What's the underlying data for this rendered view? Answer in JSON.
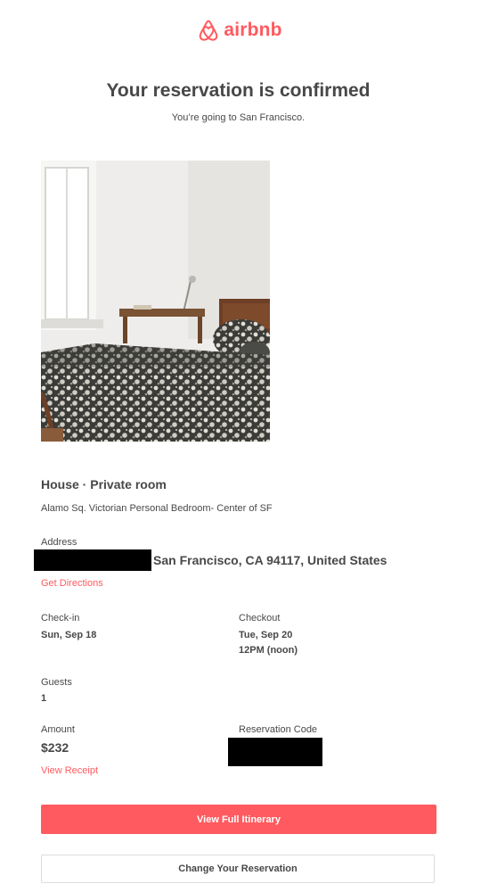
{
  "brand": {
    "name": "airbnb",
    "logo_icon": "airbnb-belo-icon",
    "color": "#FF5A5F"
  },
  "header": {
    "title": "Your reservation is confirmed",
    "subtitle": "You’re going to San Francisco."
  },
  "listing": {
    "photo_icon": "bedroom-photo",
    "room_type": "House · Private room",
    "name": "Alamo Sq. Victorian Personal Bedroom- Center of SF"
  },
  "address": {
    "label": "Address",
    "street_redacted": true,
    "text": "San Francisco, CA 94117, United States",
    "directions_link": "Get Directions"
  },
  "checkin": {
    "label": "Check-in",
    "date": "Sun, Sep 18"
  },
  "checkout": {
    "label": "Checkout",
    "date": "Tue, Sep 20",
    "time": "12PM (noon)"
  },
  "guests": {
    "label": "Guests",
    "count": "1"
  },
  "amount": {
    "label": "Amount",
    "value": "$232",
    "receipt_link": "View Receipt"
  },
  "reservation_code": {
    "label": "Reservation Code",
    "redacted": true
  },
  "actions": {
    "primary": "View Full Itinerary",
    "secondary": "Change Your Reservation"
  },
  "colors": {
    "accent": "#FF5A5F",
    "text": "#484848",
    "redaction": "#000000"
  }
}
